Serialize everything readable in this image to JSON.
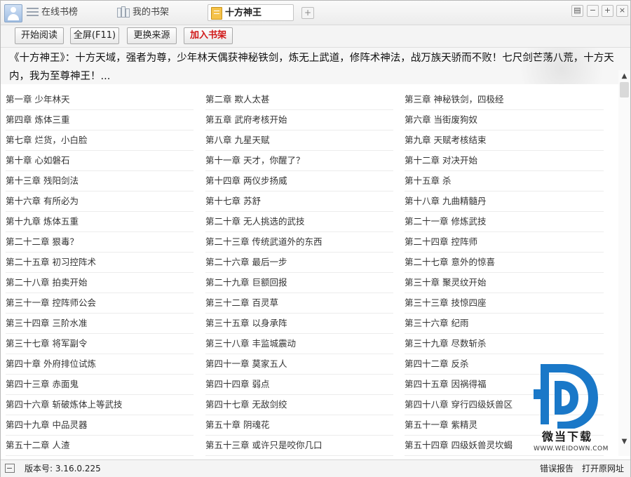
{
  "tabs": [
    {
      "label": "在线书榜"
    },
    {
      "label": "我的书架"
    },
    {
      "label": "十方神王"
    }
  ],
  "window_controls": {
    "restore": "▤",
    "min": "−",
    "max": "+",
    "close": "×"
  },
  "tab_add": "+",
  "toolbar": {
    "start_reading": "开始阅读",
    "fullscreen": "全屏(F11)",
    "change_source": "更换来源",
    "add_shelf": "加入书架"
  },
  "description": "《十方神王》：十方天域，强者为尊，少年林天偶获神秘铁剑，炼无上武道，修阵术神法，战万族天骄而不败！七尺剑芒荡八荒，十方天内，我为至尊神王！...",
  "chapters": [
    "第一章 少年林天",
    "第二章 欺人太甚",
    "第三章 神秘铁剑，四极经",
    "第四章 炼体三重",
    "第五章 武府考核开始",
    "第六章 当街废狗奴",
    "第七章 烂货，小白脸",
    "第八章 九星天赋",
    "第九章 天赋考核结束",
    "第十章 心如磐石",
    "第十一章 天才，你醒了？",
    "第十二章 对决开始",
    "第十三章 残阳剑法",
    "第十四章 两仪步扬威",
    "第十五章 杀",
    "第十六章 有所必为",
    "第十七章 苏舒",
    "第十八章 九曲精髓丹",
    "第十九章 炼体五重",
    "第二十章 无人挑选的武技",
    "第二十一章 修炼武技",
    "第二十二章 狠毒？",
    "第二十三章 传统武道外的东西",
    "第二十四章 控阵师",
    "第二十五章 初习控阵术",
    "第二十六章 最后一步",
    "第二十七章 意外的惊喜",
    "第二十八章 拍卖开始",
    "第二十九章 巨额回报",
    "第三十章 聚灵纹开始",
    "第三十一章 控阵师公会",
    "第三十二章 百灵草",
    "第三十三章 技惊四座",
    "第三十四章 三阶水准",
    "第三十五章 以身承阵",
    "第三十六章 纪雨",
    "第三十七章 将军副令",
    "第三十八章 丰监城震动",
    "第三十九章 尽数斩杀",
    "第四十章 外府排位试炼",
    "第四十一章 莫家五人",
    "第四十二章 反杀",
    "第四十三章 赤面鬼",
    "第四十四章 弱点",
    "第四十五章 因祸得福",
    "第四十六章 斩破炼体上等武技",
    "第四十七章 无敌剑绞",
    "第四十八章 穿行四级妖兽区",
    "第四十九章 中品灵器",
    "第五十章 阴魂花",
    "第五十一章 紫精灵",
    "第五十二章 人渣",
    "第五十三章 或许只是咬你几口",
    "第五十四章 四级妖兽灵坎蝎"
  ],
  "scrollbar": {
    "up": "▲",
    "down": "▼"
  },
  "watermark": {
    "name": "微当下载",
    "url": "WWW.WEIDOWN.COM",
    "brand_color": "#1a78c8"
  },
  "statusbar": {
    "version": "版本号: 3.16.0.225",
    "report": "错误报告",
    "open_source": "打开原网址"
  }
}
